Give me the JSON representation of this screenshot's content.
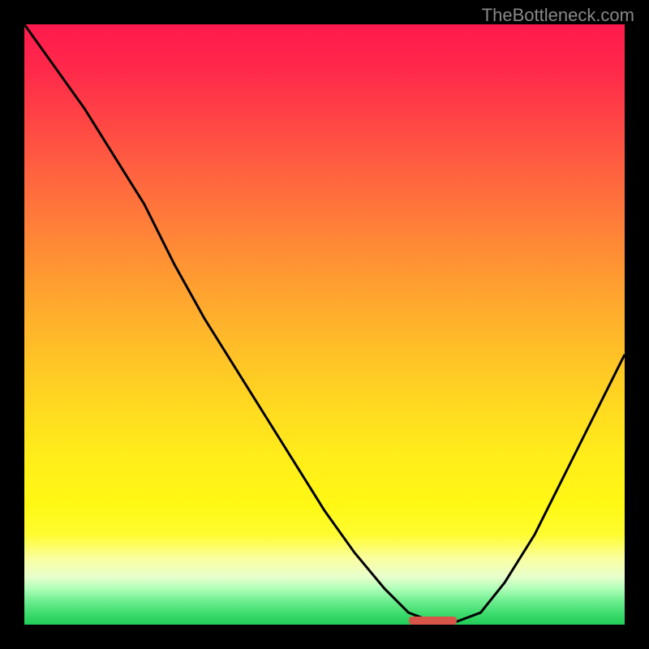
{
  "watermark": "TheBottleneck.com",
  "chart_data": {
    "type": "line",
    "title": "",
    "xlabel": "",
    "ylabel": "",
    "xlim": [
      0,
      1
    ],
    "ylim": [
      0,
      1
    ],
    "x": [
      0.0,
      0.05,
      0.1,
      0.15,
      0.2,
      0.25,
      0.3,
      0.35,
      0.4,
      0.45,
      0.5,
      0.55,
      0.6,
      0.64,
      0.68,
      0.72,
      0.76,
      0.8,
      0.85,
      0.9,
      0.95,
      1.0
    ],
    "values": [
      1.0,
      0.93,
      0.86,
      0.78,
      0.7,
      0.6,
      0.51,
      0.43,
      0.35,
      0.27,
      0.19,
      0.12,
      0.06,
      0.02,
      0.005,
      0.005,
      0.02,
      0.07,
      0.15,
      0.25,
      0.35,
      0.45
    ],
    "marker": {
      "x_start": 0.64,
      "x_end": 0.72,
      "y": 0.005
    },
    "colors": {
      "gradient_top": "#ff1a4d",
      "gradient_bottom": "#20cc55",
      "curve": "#000000",
      "marker": "#d8554a",
      "background": "#000000"
    }
  }
}
